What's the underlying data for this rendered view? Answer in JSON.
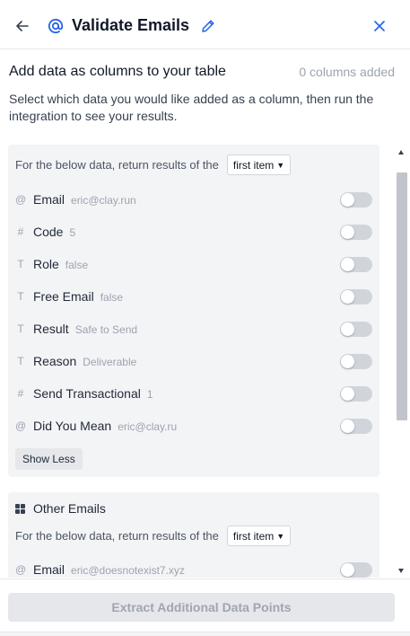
{
  "header": {
    "title": "Validate Emails",
    "icons": {
      "back": "arrow-left-icon",
      "at": "at-sign-icon",
      "edit": "pencil-icon",
      "close": "close-icon"
    },
    "accent": "#2563eb"
  },
  "section": {
    "heading": "Add data as columns to your table",
    "count": "0 columns added",
    "description": "Select which data you would like added as a column, then run the integration to see your results."
  },
  "group1": {
    "return_label": "For the below data, return results of the",
    "select_value": "first item",
    "fields": [
      {
        "icon": "@",
        "icon_name": "at-sign-icon",
        "name": "Email",
        "value": "eric@clay.run",
        "enabled": false
      },
      {
        "icon": "#",
        "icon_name": "hash-icon",
        "name": "Code",
        "value": "5",
        "enabled": false
      },
      {
        "icon": "T",
        "icon_name": "text-icon",
        "name": "Role",
        "value": "false",
        "enabled": false
      },
      {
        "icon": "T",
        "icon_name": "text-icon",
        "name": "Free Email",
        "value": "false",
        "enabled": false
      },
      {
        "icon": "T",
        "icon_name": "text-icon",
        "name": "Result",
        "value": "Safe to Send",
        "enabled": false
      },
      {
        "icon": "T",
        "icon_name": "text-icon",
        "name": "Reason",
        "value": "Deliverable",
        "enabled": false
      },
      {
        "icon": "#",
        "icon_name": "hash-icon",
        "name": "Send Transactional",
        "value": "1",
        "enabled": false
      },
      {
        "icon": "@",
        "icon_name": "at-sign-icon",
        "name": "Did You Mean",
        "value": "eric@clay.ru",
        "enabled": false
      }
    ],
    "show_less": "Show Less"
  },
  "group2": {
    "title": "Other Emails",
    "title_icon": "grid-icon",
    "return_label": "For the below data, return results of the",
    "select_value": "first item",
    "fields": [
      {
        "icon": "@",
        "icon_name": "at-sign-icon",
        "name": "Email",
        "value": "eric@doesnotexist7.xyz",
        "enabled": false
      }
    ]
  },
  "footer": {
    "button_label": "Extract Additional Data Points"
  }
}
